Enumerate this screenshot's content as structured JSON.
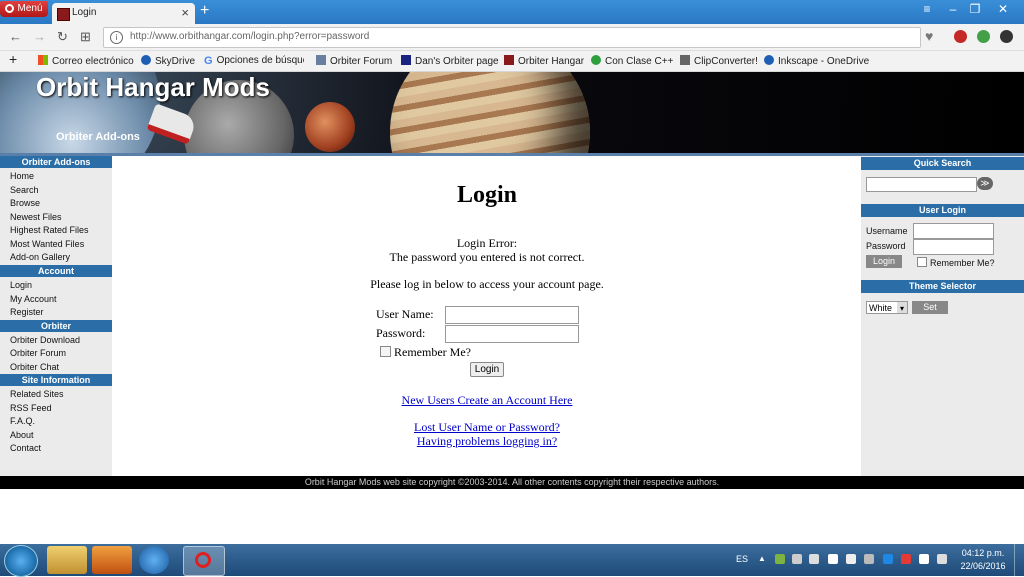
{
  "browser": {
    "menu_label": "Menú",
    "tab_title": "Login",
    "tab_close": "×",
    "new_tab": "+",
    "url": "http://www.orbithangar.com/login.php?error=password",
    "info_glyph": "i",
    "add_glyph": "+",
    "controls": {
      "menu": "≡",
      "minimize": "–",
      "restore": "❐",
      "close": "✕"
    },
    "nav": {
      "back": "←",
      "forward": "→",
      "reload": "↻",
      "grid": "⊞"
    },
    "heart": "♥",
    "bookmarks": [
      "Correo electrónico",
      "SkyDrive",
      "Opciones de búsqueda",
      "Orbiter Forum",
      "Dan's Orbiter page",
      "Orbiter Hangar",
      "Con Clase C++",
      "ClipConverter!",
      "Inkscape - OneDrive"
    ]
  },
  "banner": {
    "title": "Orbit Hangar Mods",
    "subtitle": "Orbiter Add-ons"
  },
  "leftnav": {
    "sections": [
      {
        "heading": "Orbiter Add-ons",
        "links": [
          "Home",
          "Search",
          "Browse",
          "Newest Files",
          "Highest Rated Files",
          "Most Wanted Files",
          "Add-on Gallery"
        ]
      },
      {
        "heading": "Account",
        "links": [
          "Login",
          "My Account",
          "Register"
        ]
      },
      {
        "heading": "Orbiter",
        "links": [
          "Orbiter Download",
          "Orbiter Forum",
          "Orbiter Chat"
        ]
      },
      {
        "heading": "Site Information",
        "links": [
          "Related Sites",
          "RSS Feed",
          "F.A.Q.",
          "About",
          "Contact"
        ]
      }
    ]
  },
  "main": {
    "title": "Login",
    "error_heading": "Login Error:",
    "error_message": "The password you entered is not correct.",
    "instructions": "Please log in below to access your account page.",
    "username_label": "User Name:",
    "password_label": "Password:",
    "remember_label": "Remember Me?",
    "login_button": "Login",
    "new_user_link": "New Users Create an Account Here",
    "lost_link": "Lost User Name or Password?",
    "problems_link": "Having problems logging in?"
  },
  "rightpanel": {
    "quick_search": "Quick Search",
    "search_go": "≫",
    "user_login": "User Login",
    "username": "Username",
    "password": "Password",
    "login_button": "Login",
    "remember": "Remember Me?",
    "theme_selector": "Theme Selector",
    "theme_value": "White",
    "theme_arrow": "▾",
    "set_button": "Set"
  },
  "footer": "Orbit Hangar Mods web site copyright ©2003-2014. All other contents copyright their respective authors.",
  "taskbar": {
    "lang": "ES",
    "time": "04:12 p.m.",
    "date": "22/06/2016",
    "tray_arrow": "▲"
  }
}
